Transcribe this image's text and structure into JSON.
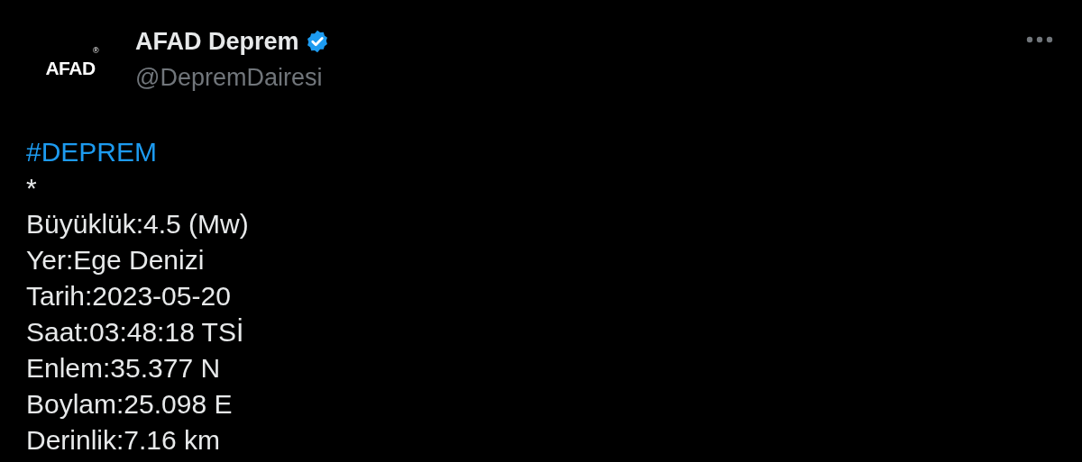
{
  "author": {
    "avatar_text": "AFAD",
    "avatar_mark": "®",
    "name": "AFAD Deprem",
    "verified": true,
    "handle": "@DepremDairesi"
  },
  "tweet": {
    "lines": [
      {
        "kind": "hashtag",
        "text": "#DEPREM"
      },
      {
        "kind": "text",
        "text": "*"
      },
      {
        "kind": "text",
        "text": "Büyüklük:4.5 (Mw)"
      },
      {
        "kind": "text",
        "text": "Yer:Ege Denizi"
      },
      {
        "kind": "text",
        "text": "Tarih:2023-05-20"
      },
      {
        "kind": "text",
        "text": "Saat:03:48:18 TSİ"
      },
      {
        "kind": "text",
        "text": "Enlem:35.377 N"
      },
      {
        "kind": "text",
        "text": "Boylam:25.098 E"
      },
      {
        "kind": "text",
        "text": "Derinlik:7.16 km"
      }
    ]
  }
}
